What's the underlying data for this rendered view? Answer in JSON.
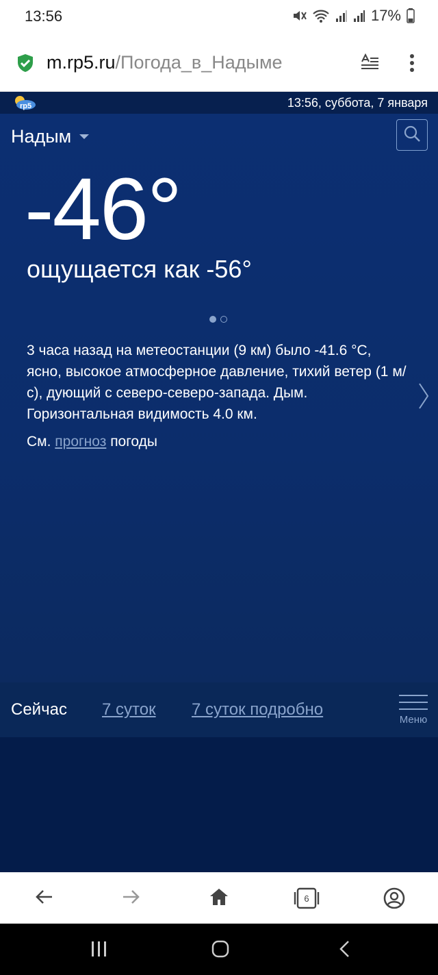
{
  "status_bar": {
    "time": "13:56",
    "battery": "17%"
  },
  "url_bar": {
    "domain": "m.rp5.ru",
    "path": "/Погода_в_Надыме"
  },
  "site_header": {
    "datetime": "13:56, суббота, 7 января",
    "logo_text": "rp5"
  },
  "weather": {
    "city": "Надым",
    "temperature": "-46°",
    "feels_like": "ощущается как -56°",
    "description": "3 часа назад на метеостанции (9 км) было -41.6 °C, ясно, высокое атмосферное давление, тихий ветер (1 м/с), дующий с северо-северо-запада. Дым. Горизонтальная видимость 4.0 км.",
    "see_prefix": "См.",
    "see_link": "прогноз",
    "see_suffix": "погоды"
  },
  "carousel": {
    "total": 2,
    "active": 1
  },
  "nav": {
    "tab_now": "Сейчас",
    "tab_7days": "7 суток",
    "tab_7days_detail": "7 суток подробно",
    "menu_label": "Меню"
  },
  "browser_bar": {
    "tab_count": "6"
  },
  "colors": {
    "background": "#0c2f72",
    "link": "#8aa4cc",
    "header": "#07204f"
  },
  "icons": [
    "shield-check-icon",
    "reader-mode-icon",
    "more-vert-icon",
    "search-icon",
    "chevron-right-icon",
    "menu-icon",
    "back-arrow-icon",
    "forward-arrow-icon",
    "home-icon",
    "tabs-icon",
    "account-icon",
    "recents-icon",
    "home-circle-icon",
    "system-back-icon"
  ]
}
